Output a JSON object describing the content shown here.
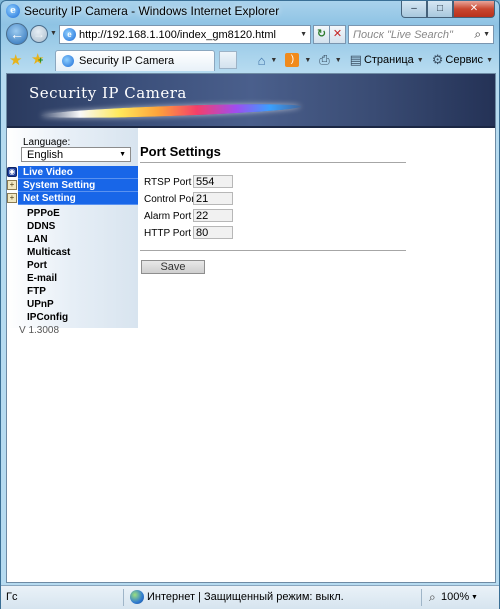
{
  "window": {
    "title": "Security IP Camera - Windows Internet Explorer",
    "minimize": "–",
    "maximize": "□",
    "close": "✕"
  },
  "address_bar": {
    "url": "http://192.168.1.100/index_gm8120.html",
    "refresh_glyph": "↻",
    "stop_glyph": "✕",
    "search_placeholder": "Поиск \"Live Search\"",
    "search_glyph": "⌕"
  },
  "toolbar": {
    "tab_label": "Security IP Camera",
    "page_menu": "Страница",
    "tools_menu": "Сервис"
  },
  "banner": {
    "brand": "Security IP Camera"
  },
  "sidebar": {
    "language_label": "Language:",
    "language_value": "English",
    "menus": [
      {
        "label": "Live Video"
      },
      {
        "label": "System Setting"
      },
      {
        "label": "Net Setting"
      }
    ],
    "net_items": [
      "PPPoE",
      "DDNS",
      "LAN",
      "Multicast",
      "Port",
      "E-mail",
      "FTP",
      "UPnP",
      "IPConfig"
    ],
    "version": "V 1.3008"
  },
  "main": {
    "title": "Port Settings",
    "fields": [
      {
        "label": "RTSP Port",
        "value": "554"
      },
      {
        "label": "Control Port",
        "value": "21"
      },
      {
        "label": "Alarm Port",
        "value": "22"
      },
      {
        "label": "HTTP Port",
        "value": "80"
      }
    ],
    "save_label": "Save"
  },
  "statusbar": {
    "left_text": "Гс",
    "zone_text": "Интернет | Защищенный режим: выкл.",
    "zoom": "100%"
  },
  "colors": {
    "menu_blue": "#1866e8",
    "banner_dark": "#2a3a5e"
  }
}
